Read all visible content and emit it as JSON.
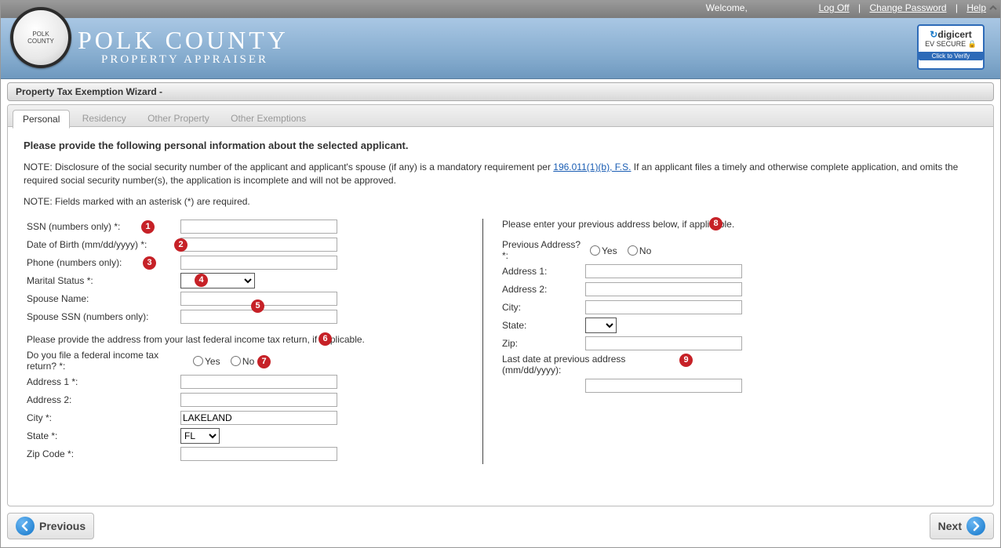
{
  "header": {
    "welcome": "Welcome,",
    "logoff": "Log Off",
    "change_password": "Change Password",
    "help": "Help",
    "title_line1": "POLK COUNTY",
    "title_line2": "PROPERTY APPRAISER",
    "digicert_logo": "digicert",
    "digicert_ev": "EV SECURE",
    "digicert_click": "Click to Verify"
  },
  "wizard_title": "Property Tax Exemption Wizard -",
  "tabs": [
    "Personal",
    "Residency",
    "Other Property",
    "Other Exemptions"
  ],
  "active_tab": "Personal",
  "intro_bold": "Please provide the following personal information about the selected applicant.",
  "note1_prefix": "NOTE: Disclosure of the social security number of the applicant and applicant's spouse (if any) is a mandatory requirement per ",
  "note1_link": "196.011(1)(b), F.S.",
  "note1_suffix": " If an applicant files a timely and otherwise complete application, and omits the required social security number(s), the application is incomplete and will not be approved.",
  "note2": "NOTE: Fields marked with an asterisk (*) are required.",
  "left": {
    "ssn_label": "SSN (numbers only) *:",
    "dob_label": "Date of Birth (mm/dd/yyyy) *:",
    "phone_label": "Phone (numbers only):",
    "marital_label": "Marital Status *:",
    "spouse_name_label": "Spouse Name:",
    "spouse_ssn_label": "Spouse SSN (numbers only):",
    "tax_section": "Please provide the address from your last federal income tax return, if applicable.",
    "tax_filed_label": "Do you file a federal income tax return? *:",
    "yes": "Yes",
    "no": "No",
    "addr1_label": "Address 1 *:",
    "addr2_label": "Address 2:",
    "city_label": "City *:",
    "city_value": "LAKELAND",
    "state_label": "State *:",
    "state_value": "FL",
    "zip_label": "Zip Code *:"
  },
  "right": {
    "prev_section": "Please enter your previous address below, if applicable.",
    "prev_addr_q": "Previous Address? *:",
    "yes": "Yes",
    "no": "No",
    "addr1_label": "Address 1:",
    "addr2_label": "Address 2:",
    "city_label": "City:",
    "state_label": "State:",
    "zip_label": "Zip:",
    "lastdate_label": "Last date at previous address (mm/dd/yyyy):"
  },
  "callouts": [
    "1",
    "2",
    "3",
    "4",
    "5",
    "6",
    "7",
    "8",
    "9"
  ],
  "nav": {
    "previous": "Previous",
    "next": "Next"
  }
}
